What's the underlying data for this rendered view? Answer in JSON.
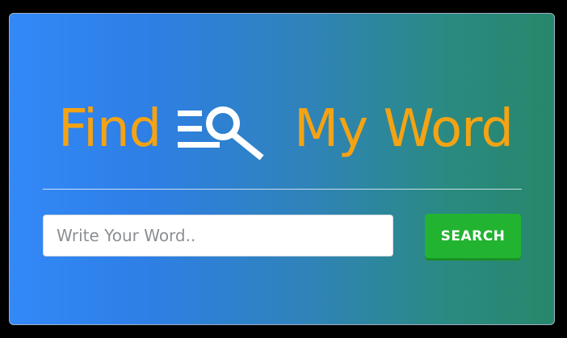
{
  "header": {
    "title_left": "Find",
    "title_right": "My Word",
    "logo_icon": "search-list-icon"
  },
  "search": {
    "placeholder": "Write Your Word..",
    "value": "",
    "button_label": "SEARCH"
  },
  "colors": {
    "title": "#f5a313",
    "gradient_start": "#3389f7",
    "gradient_end": "#27876a",
    "button": "#22b431",
    "page_background": "#000000"
  }
}
